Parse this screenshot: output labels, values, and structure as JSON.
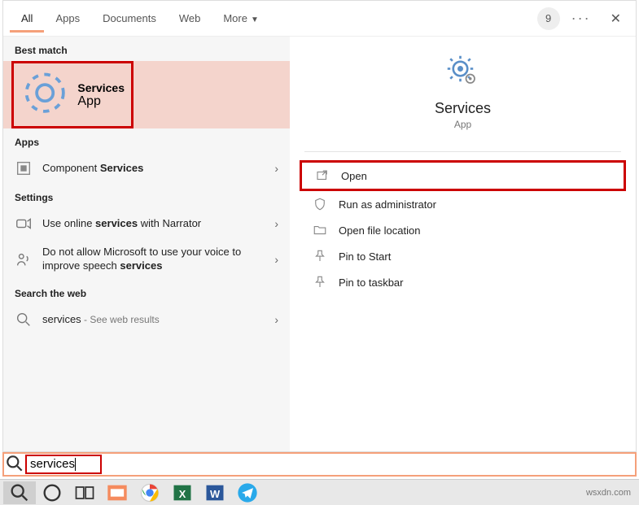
{
  "tabs": {
    "all": "All",
    "apps": "Apps",
    "documents": "Documents",
    "web": "Web",
    "more": "More"
  },
  "badge": "9",
  "sections": {
    "best_match": "Best match",
    "apps": "Apps",
    "settings": "Settings",
    "web": "Search the web"
  },
  "best": {
    "title": "Services",
    "sub": "App"
  },
  "apps_results": {
    "component_pre": "Component ",
    "component_bold": "Services"
  },
  "settings_results": {
    "narrator_pre": "Use online ",
    "narrator_bold": "services",
    "narrator_post": " with Narrator",
    "speech_pre": "Do not allow Microsoft to use your voice to improve speech ",
    "speech_bold": "services"
  },
  "web_results": {
    "query": "services",
    "hint": " - See web results"
  },
  "detail": {
    "title": "Services",
    "sub": "App"
  },
  "actions": {
    "open": "Open",
    "run_admin": "Run as administrator",
    "open_loc": "Open file location",
    "pin_start": "Pin to Start",
    "pin_taskbar": "Pin to taskbar"
  },
  "search_value": "services",
  "watermark": "wsxdn.com"
}
